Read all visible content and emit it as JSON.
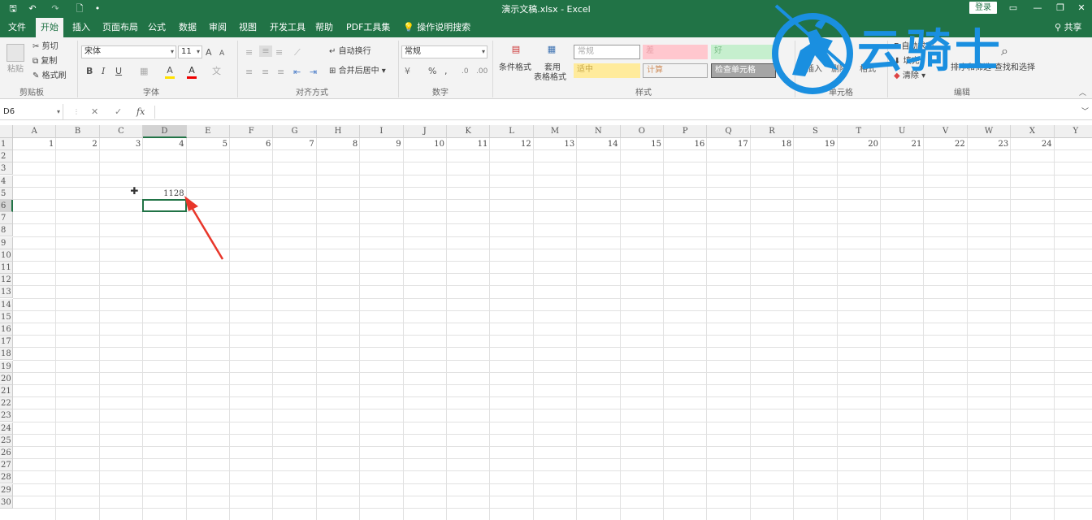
{
  "quick_access": {
    "save": "🖫",
    "undo": "↶",
    "redo": "↷",
    "preview": "🗋",
    "more": "•"
  },
  "window": {
    "title": "演示文稿.xlsx  -  Excel",
    "login": "登录"
  },
  "tabs": [
    "文件",
    "开始",
    "插入",
    "页面布局",
    "公式",
    "数据",
    "审阅",
    "视图",
    "开发工具",
    "帮助",
    "PDF工具集",
    "操作说明搜索"
  ],
  "share": "共享",
  "clipboard": {
    "paste": "粘贴",
    "cut": "剪切",
    "copy": "复制",
    "format_painter": "格式刷",
    "group": "剪贴板"
  },
  "font": {
    "name": "宋体",
    "size": "11",
    "grow": "A",
    "shrink": "A",
    "bold": "B",
    "italic": "I",
    "underline": "U",
    "fill_color": "A",
    "font_color": "A",
    "phonetic": "文",
    "group": "字体"
  },
  "alignment": {
    "wrap": "自动换行",
    "merge": "合并后居中",
    "group": "对齐方式"
  },
  "number": {
    "format": "常规",
    "percent": "%",
    "comma": ",",
    "currency": "¥",
    "group": "数字"
  },
  "styles": {
    "conditional": "条件格式",
    "table_format_1": "套用",
    "table_format_2": "表格格式",
    "normal": "常规",
    "bad": "差",
    "good": "好",
    "neutral": "适中",
    "calc": "计算",
    "check": "检查单元格",
    "group": "样式"
  },
  "cells": {
    "insert": "插入",
    "delete": "删除",
    "format": "格式",
    "group": "单元格"
  },
  "editing": {
    "autosum": "自动求和",
    "fill": "填充",
    "clear": "清除",
    "sort": "排序和筛选",
    "find": "查找和选择",
    "group": "编辑"
  },
  "watermark": {
    "text": "云骑士"
  },
  "formula_bar": {
    "name_box": "D6",
    "cancel": "✕",
    "enter": "✓",
    "fx": "fx",
    "formula": ""
  },
  "columns": [
    "A",
    "B",
    "C",
    "D",
    "E",
    "F",
    "G",
    "H",
    "I",
    "J",
    "K",
    "L",
    "M",
    "N",
    "O",
    "P",
    "Q",
    "R",
    "S",
    "T",
    "U",
    "V",
    "W",
    "X",
    "Y"
  ],
  "rows": [
    "1",
    "2",
    "3",
    "4",
    "5",
    "6",
    "7",
    "8",
    "9",
    "10",
    "11",
    "12",
    "13",
    "14",
    "15",
    "16",
    "17",
    "18",
    "19",
    "20",
    "21",
    "22",
    "23",
    "24",
    "25",
    "26",
    "27",
    "28",
    "29",
    "30"
  ],
  "row1_values": [
    "1",
    "2",
    "3",
    "4",
    "5",
    "6",
    "7",
    "8",
    "9",
    "10",
    "11",
    "12",
    "13",
    "14",
    "15",
    "16",
    "17",
    "18",
    "19",
    "20",
    "21",
    "22",
    "23",
    "24"
  ],
  "cell_D5": "1128",
  "selected_cell": "D6",
  "colors": {
    "excel_green": "#217346",
    "annotation_red": "#e8362a",
    "watermark_blue": "#1a8fe0"
  }
}
